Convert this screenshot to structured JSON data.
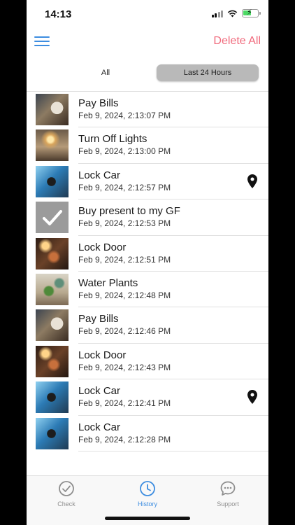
{
  "status_bar": {
    "time": "14:13"
  },
  "header": {
    "delete_all_label": "Delete All"
  },
  "filters": {
    "options": [
      "All",
      "Last 24 Hours"
    ],
    "selected": "Last 24 Hours"
  },
  "history": [
    {
      "title": "Pay Bills",
      "date": "Feb 9, 2024, 2:13:07 PM",
      "thumb": "pay-bills-image",
      "has_location": false
    },
    {
      "title": "Turn Off Lights",
      "date": "Feb 9, 2024, 2:13:00 PM",
      "thumb": "turn-off-lights-image",
      "has_location": false
    },
    {
      "title": "Lock Car",
      "date": "Feb 9, 2024, 2:12:57 PM",
      "thumb": "lock-car-image",
      "has_location": true
    },
    {
      "title": "Buy present to my GF",
      "date": "Feb 9, 2024, 2:12:53 PM",
      "thumb": "checkmark-placeholder",
      "has_location": false
    },
    {
      "title": "Lock Door",
      "date": "Feb 9, 2024, 2:12:51 PM",
      "thumb": "lock-door-image",
      "has_location": false
    },
    {
      "title": "Water Plants",
      "date": "Feb 9, 2024, 2:12:48 PM",
      "thumb": "water-plants-image",
      "has_location": false
    },
    {
      "title": "Pay Bills",
      "date": "Feb 9, 2024, 2:12:46 PM",
      "thumb": "pay-bills-image",
      "has_location": false
    },
    {
      "title": "Lock Door",
      "date": "Feb 9, 2024, 2:12:43 PM",
      "thumb": "lock-door-image",
      "has_location": false
    },
    {
      "title": "Lock Car",
      "date": "Feb 9, 2024, 2:12:41 PM",
      "thumb": "lock-car-image",
      "has_location": true
    },
    {
      "title": "Lock Car",
      "date": "Feb 9, 2024, 2:12:28 PM",
      "thumb": "lock-car-image",
      "has_location": false
    }
  ],
  "tab_bar": {
    "tabs": [
      {
        "label": "Check",
        "icon": "checkmark-circle-icon"
      },
      {
        "label": "History",
        "icon": "clock-icon"
      },
      {
        "label": "Support",
        "icon": "chat-bubble-icon"
      }
    ],
    "active": "History"
  },
  "colors": {
    "accent": "#3d8de0",
    "danger": "#f06a7c",
    "segment_active": "#b9b9b9"
  }
}
